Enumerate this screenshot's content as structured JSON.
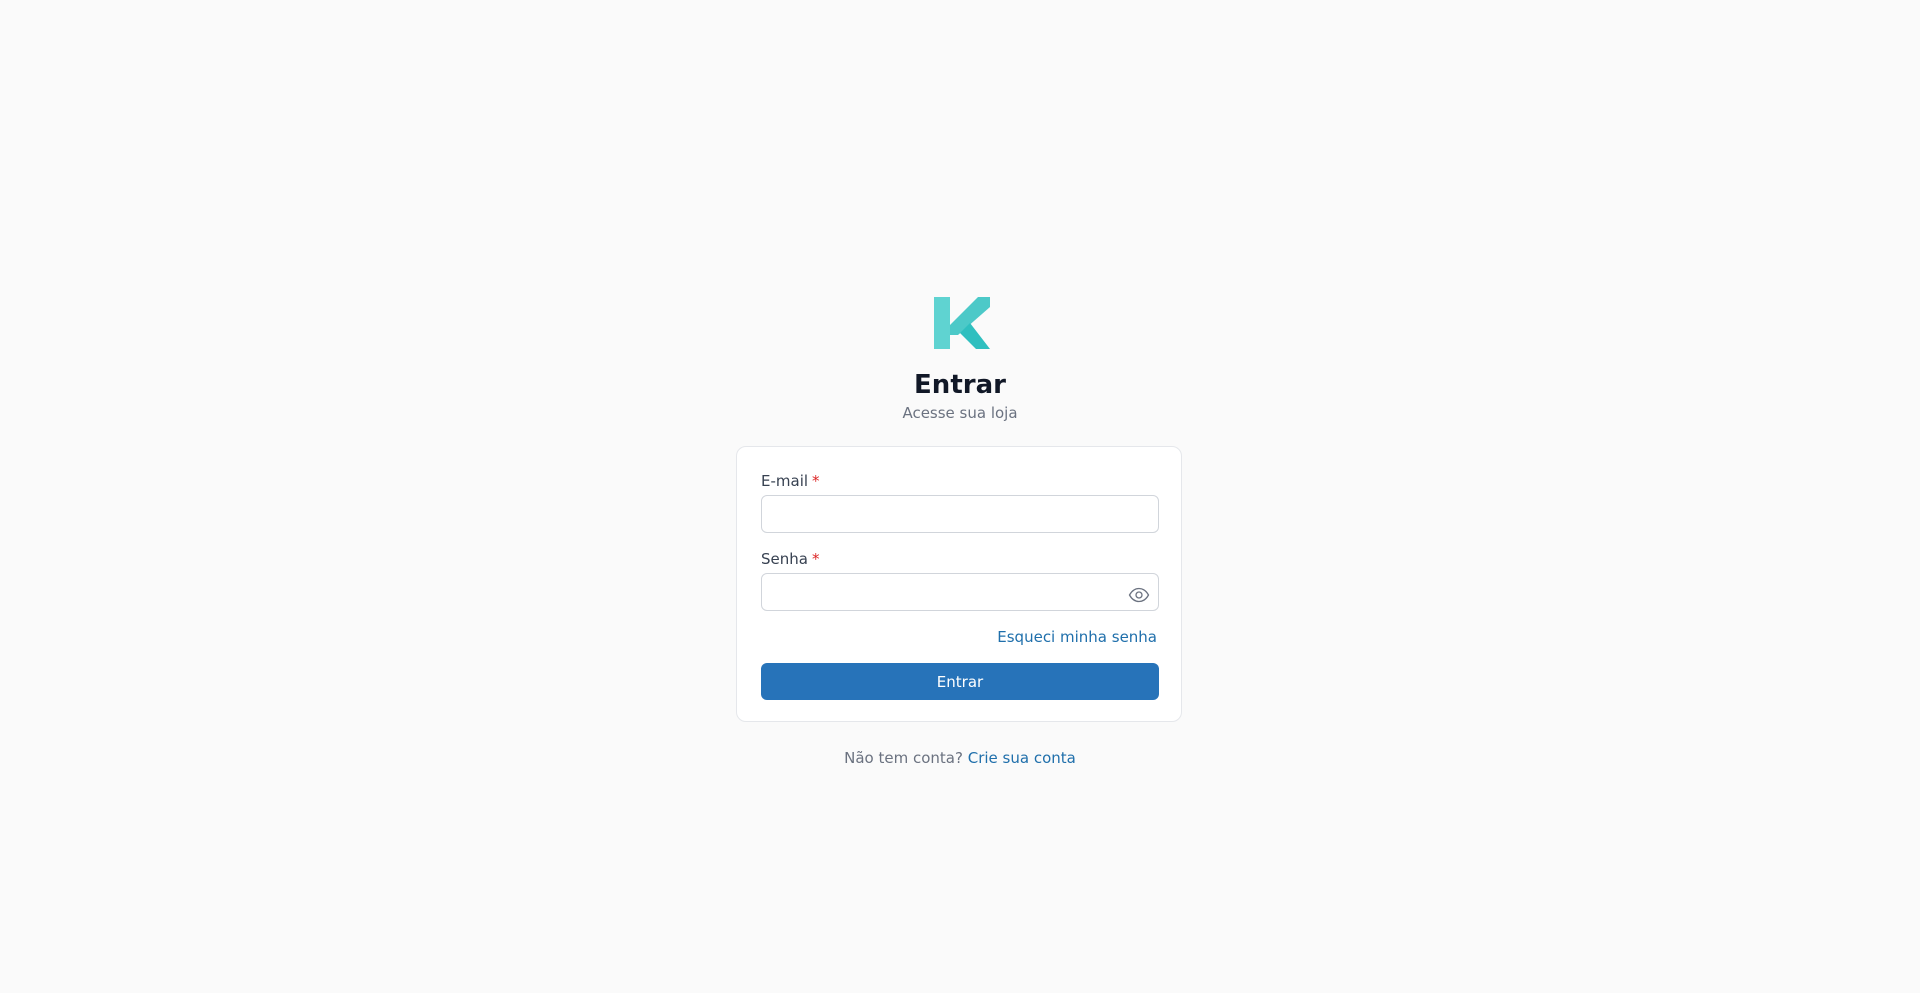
{
  "header": {
    "title": "Entrar",
    "subtitle": "Acesse sua loja"
  },
  "form": {
    "email": {
      "label": "E-mail",
      "required_mark": "*",
      "value": "",
      "placeholder": ""
    },
    "password": {
      "label": "Senha",
      "required_mark": "*",
      "value": "",
      "placeholder": "",
      "toggle_icon": "eye-icon"
    },
    "forgot_link": "Esqueci minha senha",
    "submit_label": "Entrar"
  },
  "footer": {
    "prompt": "Não tem conta?",
    "signup_link": "Crie sua conta"
  },
  "colors": {
    "brand_teal": "#4fd1cf",
    "primary_button": "#2773b9",
    "link": "#1f6fab",
    "required": "#dc2626",
    "background": "#fafafa"
  },
  "logo": {
    "icon": "k-logo-icon"
  }
}
